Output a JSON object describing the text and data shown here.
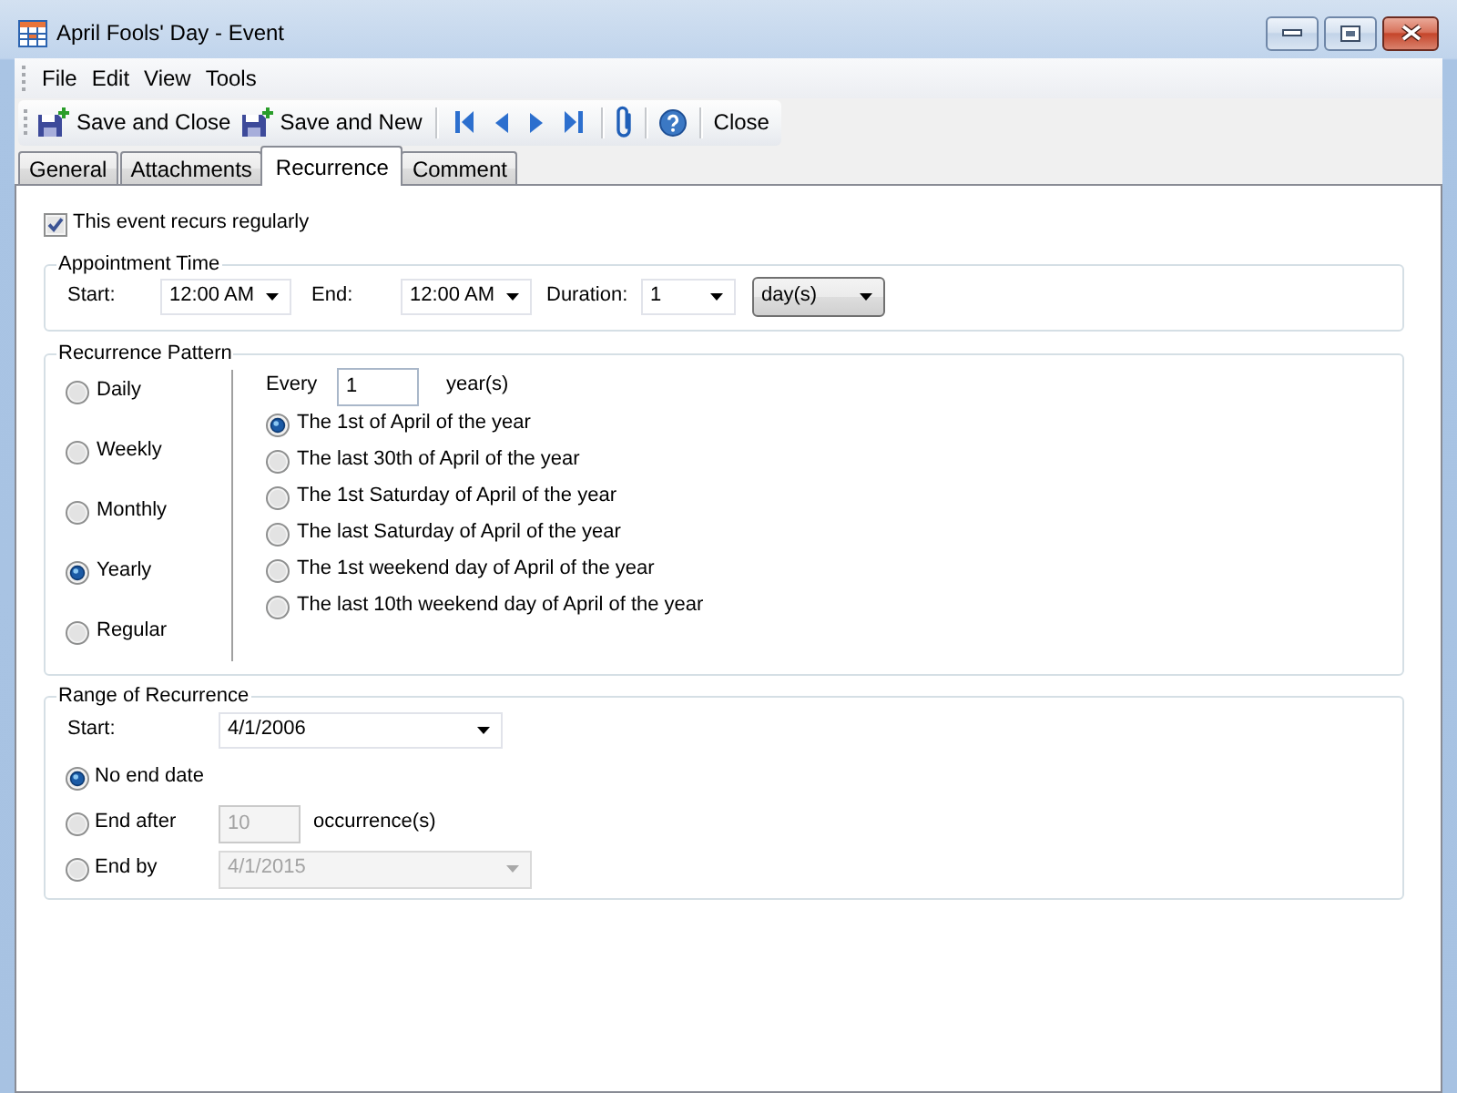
{
  "window": {
    "title": "April Fools' Day - Event"
  },
  "menu": [
    "File",
    "Edit",
    "View",
    "Tools"
  ],
  "toolbar": {
    "save_buttons": [
      "Save and Close",
      "Save and New"
    ],
    "close": "Close"
  },
  "tabs": [
    {
      "label": "General",
      "selected": false
    },
    {
      "label": "Attachments",
      "selected": false
    },
    {
      "label": "Recurrence",
      "selected": true
    },
    {
      "label": "Comment",
      "selected": false
    }
  ],
  "recurs": {
    "label": "This event recurs regularly",
    "checked": true
  },
  "appointment_time": {
    "title": "Appointment Time",
    "start": {
      "label": "Start:",
      "value": "12:00 AM"
    },
    "end": {
      "label": "End:",
      "value": "12:00 AM"
    },
    "duration": {
      "label": "Duration:",
      "value": "1",
      "unit": "day(s)"
    }
  },
  "recurrence_pattern": {
    "title": "Recurrence Pattern",
    "frequencies": [
      {
        "label": "Daily",
        "selected": false
      },
      {
        "label": "Weekly",
        "selected": false
      },
      {
        "label": "Monthly",
        "selected": false
      },
      {
        "label": "Yearly",
        "selected": true
      },
      {
        "label": "Regular",
        "selected": false
      }
    ],
    "every": {
      "label": "Every",
      "value": "1",
      "unit": "year(s)"
    },
    "options": [
      {
        "label": "The 1st of April of the year",
        "selected": true
      },
      {
        "label": "The last 30th of April of the year",
        "selected": false
      },
      {
        "label": "The 1st Saturday of April of the year",
        "selected": false
      },
      {
        "label": "The last Saturday of April of the year",
        "selected": false
      },
      {
        "label": "The 1st weekend day of April of the year",
        "selected": false
      },
      {
        "label": "The last 10th weekend day of April of the year",
        "selected": false
      }
    ]
  },
  "range_of_recurrence": {
    "title": "Range of Recurrence",
    "start": {
      "label": "Start:",
      "value": "4/1/2006"
    },
    "ends": [
      {
        "kind": "none",
        "label": "No end date",
        "selected": true
      },
      {
        "kind": "after",
        "label": "End after",
        "selected": false,
        "value": "10",
        "unit": "occurrence(s)",
        "disabled": true
      },
      {
        "kind": "by",
        "label": "End by",
        "selected": false,
        "value": "4/1/2015",
        "disabled": true
      }
    ]
  }
}
